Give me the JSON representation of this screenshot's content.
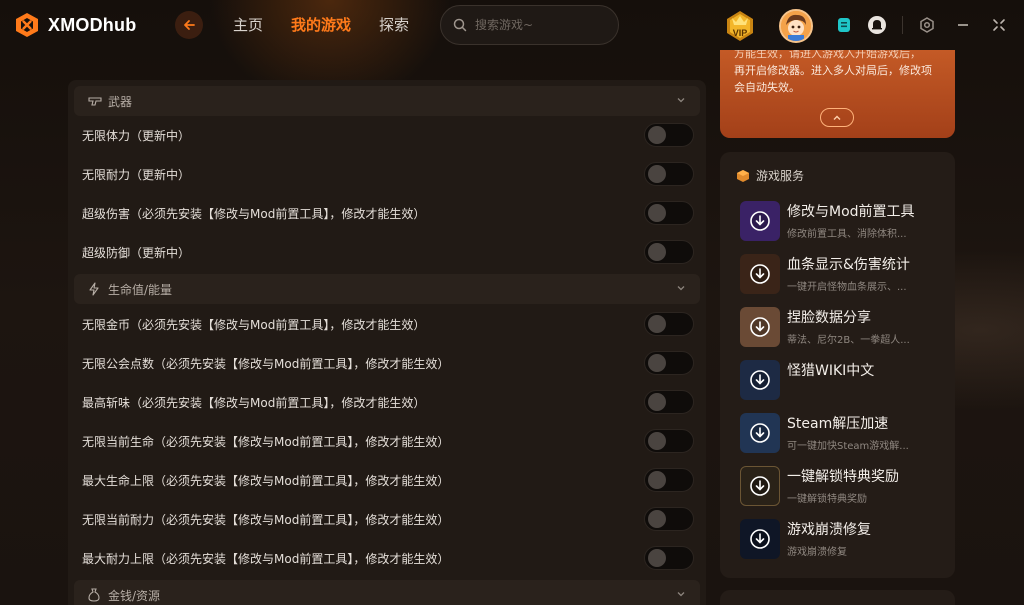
{
  "app": {
    "name": "XMODhub"
  },
  "nav": {
    "items": [
      "主页",
      "我的游戏",
      "探索"
    ],
    "active": 1
  },
  "search": {
    "placeholder": "搜索游戏~"
  },
  "badges": {
    "vip": "VIP"
  },
  "colors": {
    "accent": "#ff7a1a",
    "notice_bg": "#b44b1f",
    "panel_bg": "#211a15"
  },
  "notice": {
    "cut_line": "方能生效，请进入游戏入开始游戏后，",
    "text": "再开启修改器。进入多人对局后，修改项会自动失效。"
  },
  "sections": [
    {
      "title": "武器",
      "icon": "gun-icon",
      "items": [
        {
          "label": "无限体力（更新中）",
          "enabled": false
        },
        {
          "label": "无限耐力（更新中）",
          "enabled": false
        },
        {
          "label": "超级伤害（必须先安装【修改与Mod前置工具】，修改才能生效）",
          "enabled": false
        },
        {
          "label": "超级防御（更新中）",
          "enabled": false
        }
      ]
    },
    {
      "title": "生命值/能量",
      "icon": "lightning-icon",
      "items": [
        {
          "label": "无限金币（必须先安装【修改与Mod前置工具】，修改才能生效）",
          "enabled": false
        },
        {
          "label": "无限公会点数（必须先安装【修改与Mod前置工具】，修改才能生效）",
          "enabled": false
        },
        {
          "label": "最高斩味（必须先安装【修改与Mod前置工具】，修改才能生效）",
          "enabled": false
        },
        {
          "label": "无限当前生命（必须先安装【修改与Mod前置工具】，修改才能生效）",
          "enabled": false
        },
        {
          "label": "最大生命上限（必须先安装【修改与Mod前置工具】，修改才能生效）",
          "enabled": false
        },
        {
          "label": "无限当前耐力（必须先安装【修改与Mod前置工具】，修改才能生效）",
          "enabled": false
        },
        {
          "label": "最大耐力上限（必须先安装【修改与Mod前置工具】，修改才能生效）",
          "enabled": false
        }
      ]
    },
    {
      "title": "金钱/资源",
      "icon": "money-bag-icon",
      "items": []
    }
  ],
  "services": {
    "title": "游戏服务",
    "items": [
      {
        "title": "修改与Mod前置工具",
        "sub": "修改前置工具、消除体积...",
        "thumb": "#3a2266"
      },
      {
        "title": "血条显示&伤害统计",
        "sub": "一键开启怪物血条展示、...",
        "thumb": "#3a2418"
      },
      {
        "title": "捏脸数据分享",
        "sub": "蒂法、尼尔2B、一拳超人...",
        "thumb": "#6a4a35"
      },
      {
        "title": "怪猎WIKI中文",
        "sub": "",
        "thumb": "#1d2a44"
      },
      {
        "title": "Steam解压加速",
        "sub": "可一键加快Steam游戏解...",
        "thumb": "#213554"
      },
      {
        "title": "一键解锁特典奖励",
        "sub": "一键解锁特典奖励",
        "thumb": "#2a2218"
      },
      {
        "title": "游戏崩溃修复",
        "sub": "游戏崩溃修复",
        "thumb": "#0f1626"
      }
    ]
  }
}
